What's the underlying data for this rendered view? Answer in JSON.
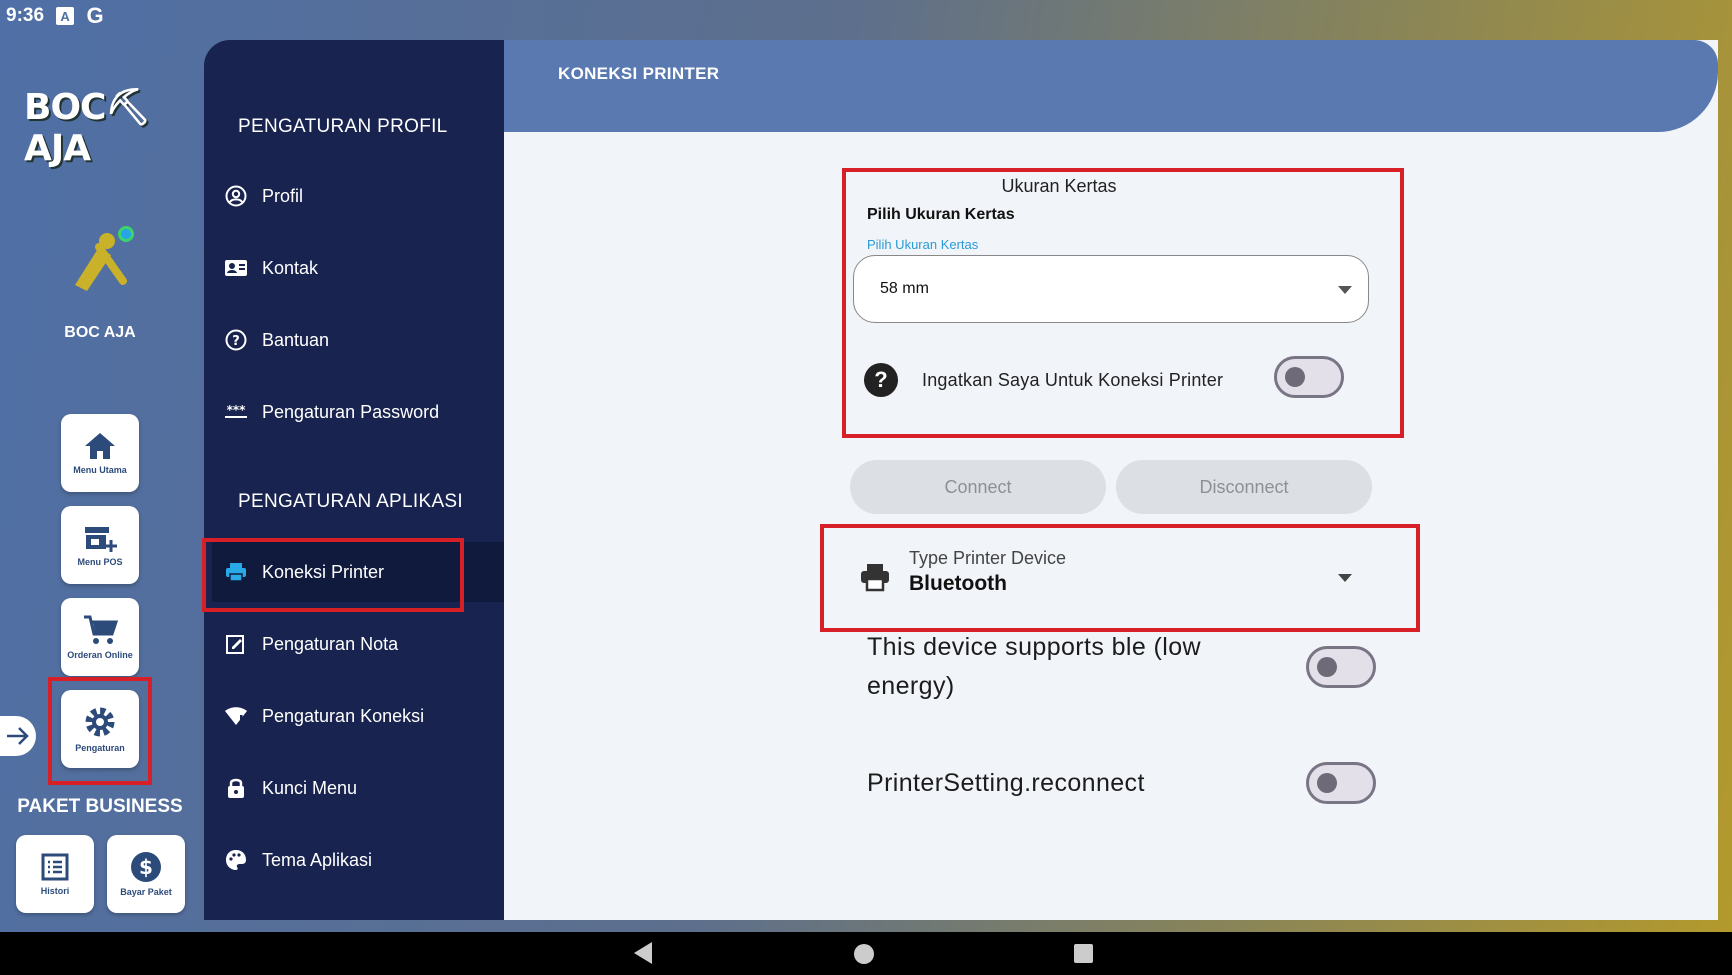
{
  "status_bar": {
    "time": "9:36",
    "icons": [
      "a-icon",
      "google-icon"
    ],
    "a_glyph": "A",
    "g_glyph": "G"
  },
  "rail": {
    "logo_text": "BOC⛏AJA",
    "brand_name": "BOC AJA",
    "buttons": [
      {
        "label": "Menu Utama",
        "icon": "home-icon"
      },
      {
        "label": "Menu POS",
        "icon": "store-add-icon"
      },
      {
        "label": "Orderan Online",
        "icon": "cart-icon"
      },
      {
        "label": "Pengaturan",
        "icon": "gear-icon"
      }
    ],
    "paket": "PAKET BUSINESS",
    "bottom_buttons": [
      {
        "label": "Histori",
        "icon": "list-icon"
      },
      {
        "label": "Bayar Paket",
        "icon": "dollar-icon"
      }
    ]
  },
  "menu": {
    "section_profile": "PENGATURAN PROFIL",
    "profile_items": [
      {
        "label": "Profil",
        "icon": "account-circle-icon"
      },
      {
        "label": "Kontak",
        "icon": "contact-card-icon"
      },
      {
        "label": "Bantuan",
        "icon": "help-circle-icon"
      },
      {
        "label": "Pengaturan Password",
        "icon": "password-icon"
      }
    ],
    "section_app": "PENGATURAN APLIKASI",
    "app_items": [
      {
        "label": "Koneksi Printer",
        "icon": "printer-icon",
        "active": true
      },
      {
        "label": "Pengaturan Nota",
        "icon": "note-edit-icon"
      },
      {
        "label": "Pengaturan Koneksi",
        "icon": "wifi-alert-icon"
      },
      {
        "label": "Kunci Menu",
        "icon": "lock-icon"
      },
      {
        "label": "Tema Aplikasi",
        "icon": "palette-icon"
      }
    ]
  },
  "content": {
    "title": "KONEKSI PRINTER",
    "paper_card_title": "Ukuran Kertas",
    "paper_label": "Pilih Ukuran Kertas",
    "paper_float_label": "Pilih Ukuran Kertas",
    "paper_value": "58 mm",
    "help_glyph": "?",
    "remember_label": "Ingatkan Saya Untuk Koneksi Printer",
    "remember_on": false,
    "connect_label": "Connect",
    "disconnect_label": "Disconnect",
    "printer_type_label": "Type Printer Device",
    "printer_type_value": "Bluetooth",
    "ble_label_line1": "This device supports ble (low",
    "ble_label_line2": "energy)",
    "ble_on": false,
    "reconnect_label": "PrinterSetting.reconnect",
    "reconnect_on": false
  },
  "colors": {
    "accent_red": "#d61f26",
    "menu_bg": "#18244f",
    "header_bg": "#5a79b1",
    "printer_active_icon": "#29a9e6"
  }
}
